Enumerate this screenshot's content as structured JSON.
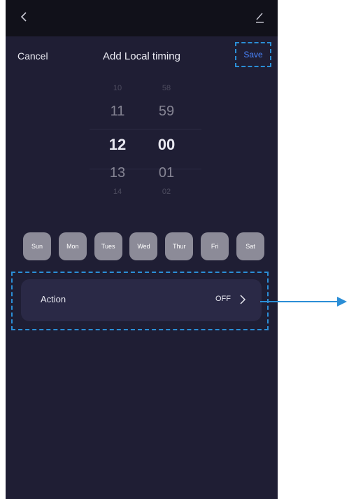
{
  "header": {
    "cancel_label": "Cancel",
    "title": "Add Local timing",
    "save_label": "Save"
  },
  "picker": {
    "hours": [
      "10",
      "11",
      "12",
      "13",
      "14"
    ],
    "minutes": [
      "58",
      "59",
      "00",
      "01",
      "02"
    ],
    "selected_hour": "12",
    "selected_minute": "00"
  },
  "days": [
    "Sun",
    "Mon",
    "Tues",
    "Wed",
    "Thur",
    "Fri",
    "Sat"
  ],
  "action": {
    "label": "Action",
    "value": "OFF"
  },
  "icons": {
    "back": "chevron-left-icon",
    "edit": "edit-icon",
    "action_chevron": "chevron-right-icon",
    "callout": "arrow-right-icon"
  },
  "colors": {
    "background": "#1f1e34",
    "topbar": "#11111a",
    "save_text": "#4a86ff",
    "highlight": "#2b8ed6",
    "day_chip": "#8c8b98"
  }
}
